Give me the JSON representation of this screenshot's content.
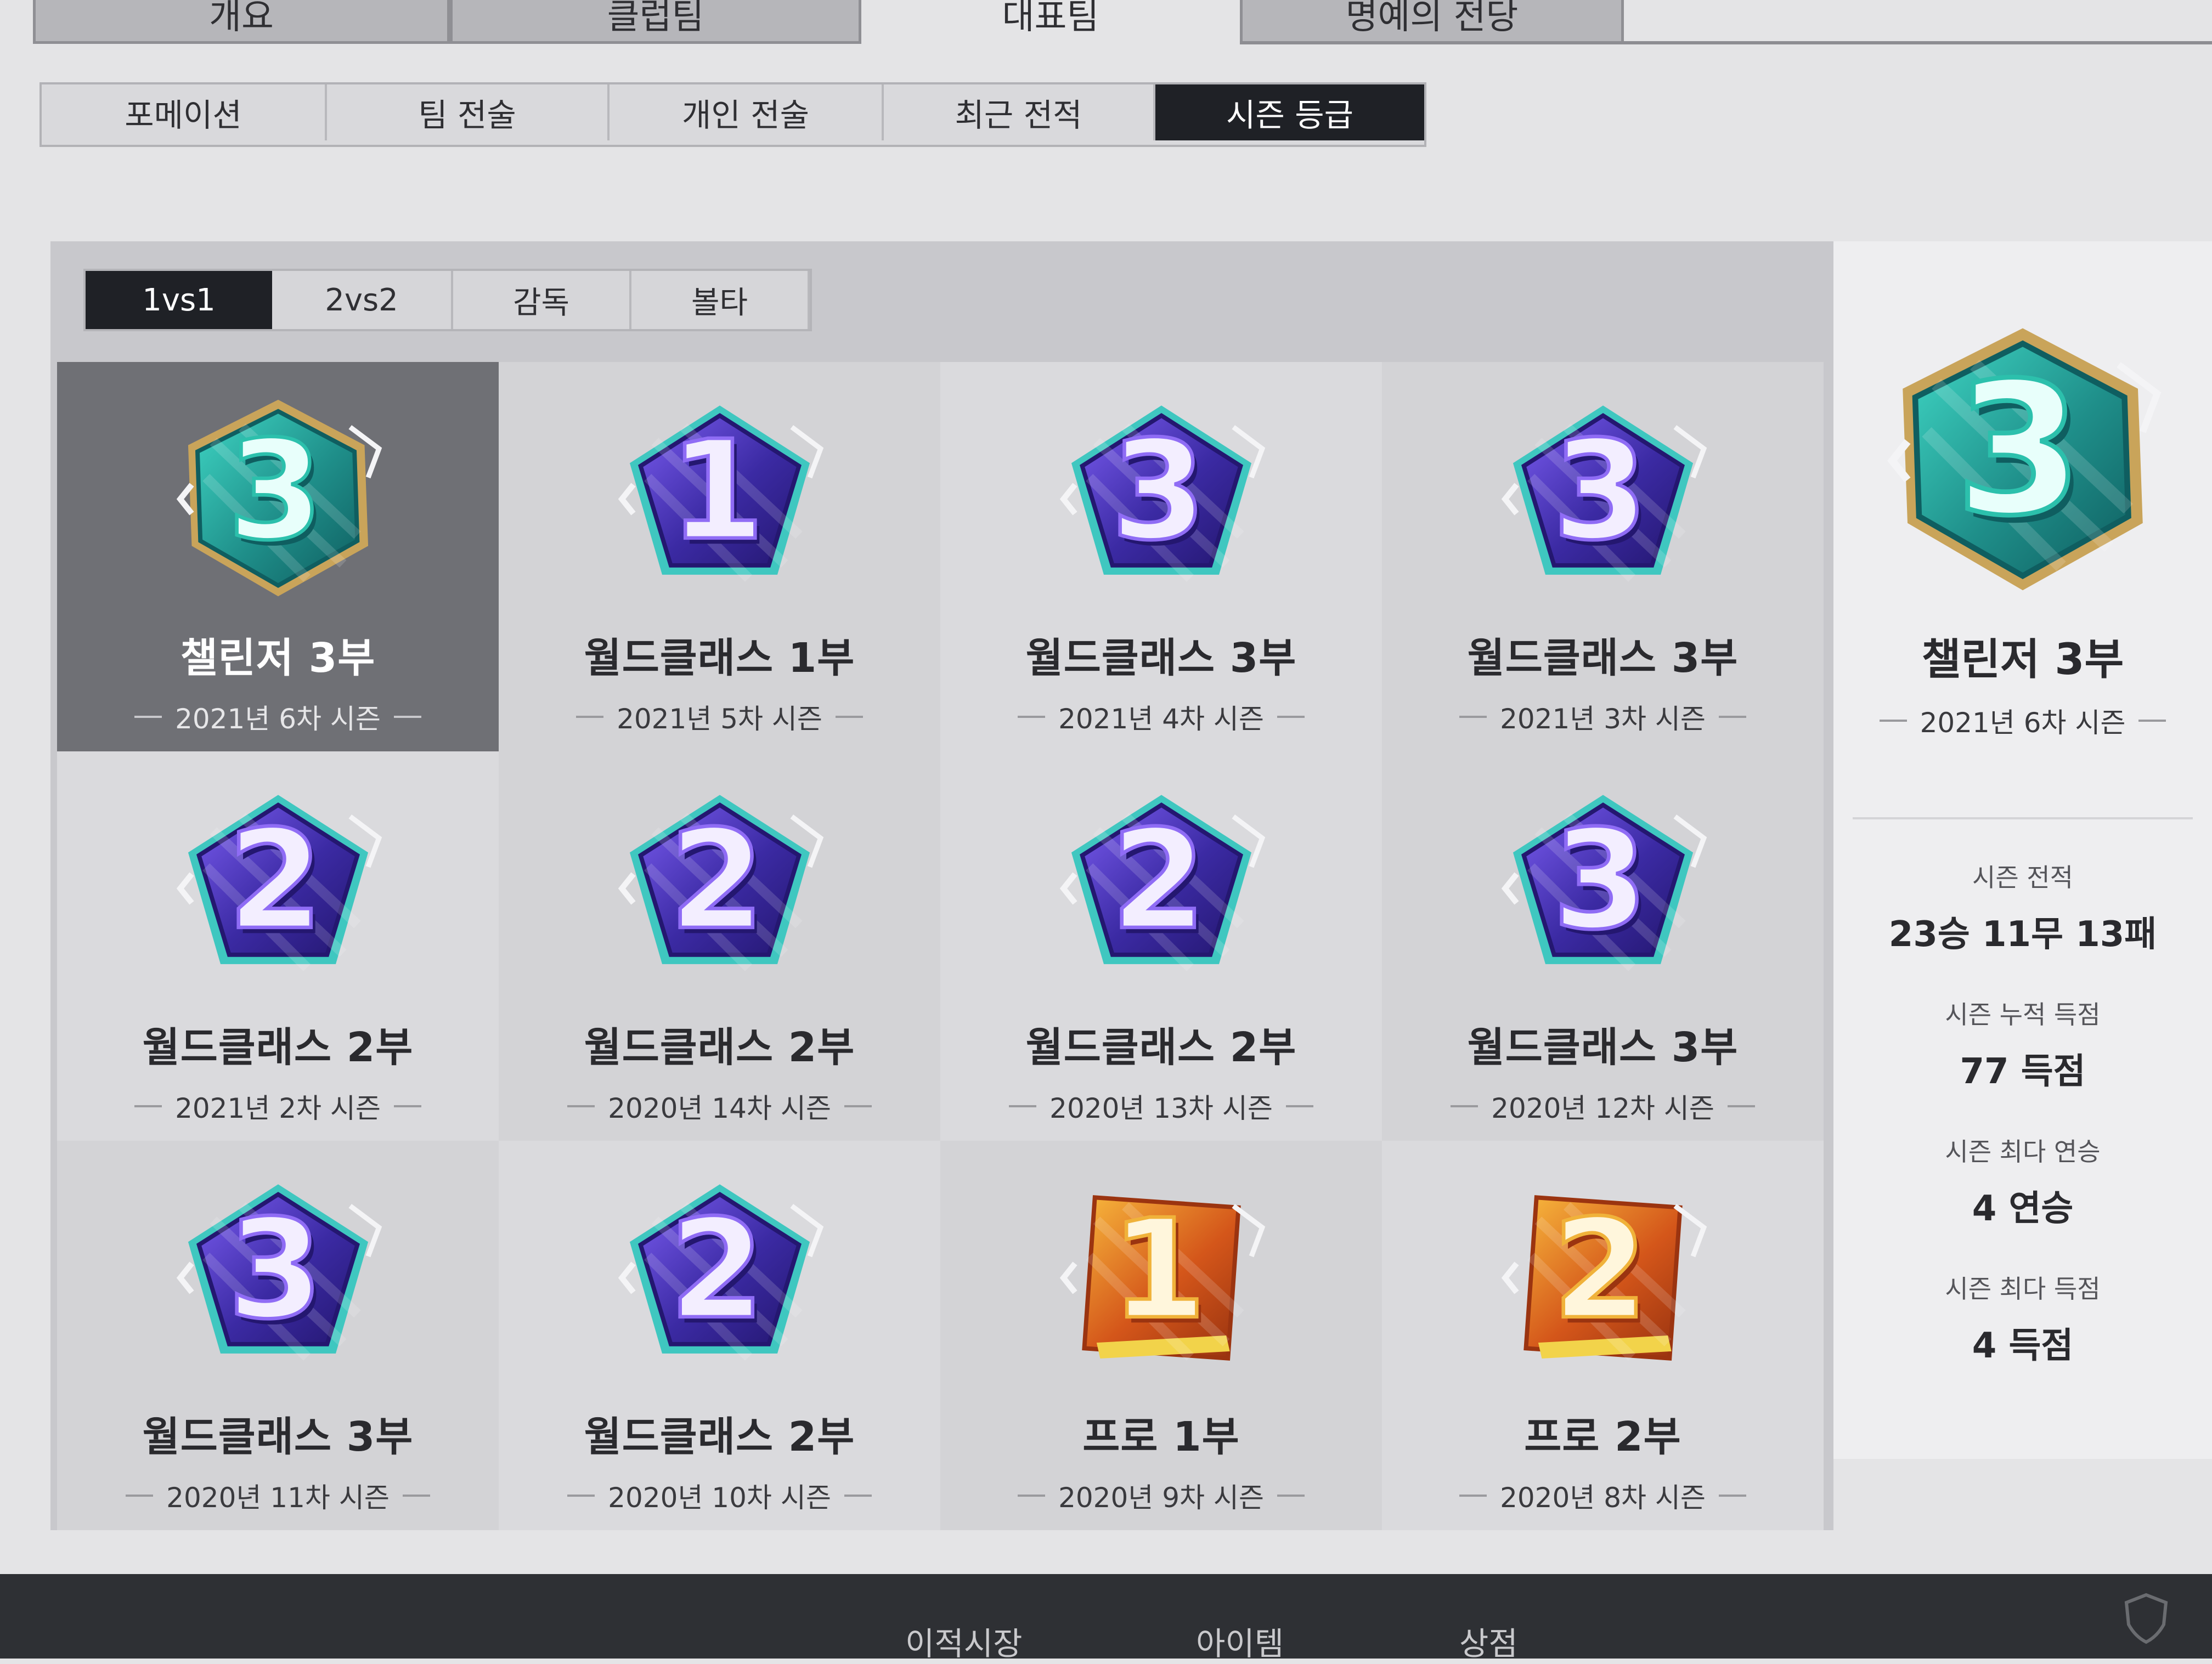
{
  "main_tabs": [
    "개요",
    "클럽팀",
    "대표팀",
    "명예의 전당"
  ],
  "sub_tabs": [
    "포메이션",
    "팀 전술",
    "개인 전술",
    "최근 전적",
    "시즌 등급"
  ],
  "mode_tabs": [
    "1vs1",
    "2vs2",
    "감독",
    "볼타"
  ],
  "cards": [
    {
      "digit": "3",
      "tier": "챌린저 3부",
      "season": "2021년 6차 시즌",
      "style": "teal"
    },
    {
      "digit": "1",
      "tier": "월드클래스 1부",
      "season": "2021년 5차 시즌",
      "style": "purple"
    },
    {
      "digit": "3",
      "tier": "월드클래스 3부",
      "season": "2021년 4차 시즌",
      "style": "purple"
    },
    {
      "digit": "3",
      "tier": "월드클래스 3부",
      "season": "2021년 3차 시즌",
      "style": "purple"
    },
    {
      "digit": "2",
      "tier": "월드클래스 2부",
      "season": "2021년 2차 시즌",
      "style": "purple"
    },
    {
      "digit": "2",
      "tier": "월드클래스 2부",
      "season": "2020년 14차 시즌",
      "style": "purple"
    },
    {
      "digit": "2",
      "tier": "월드클래스 2부",
      "season": "2020년 13차 시즌",
      "style": "purple"
    },
    {
      "digit": "3",
      "tier": "월드클래스 3부",
      "season": "2020년 12차 시즌",
      "style": "purple"
    },
    {
      "digit": "3",
      "tier": "월드클래스 3부",
      "season": "2020년 11차 시즌",
      "style": "purple"
    },
    {
      "digit": "2",
      "tier": "월드클래스 2부",
      "season": "2020년 10차 시즌",
      "style": "purple"
    },
    {
      "digit": "1",
      "tier": "프로 1부",
      "season": "2020년 9차 시즌",
      "style": "orange"
    },
    {
      "digit": "2",
      "tier": "프로 2부",
      "season": "2020년 8차 시즌",
      "style": "orange"
    }
  ],
  "current": {
    "digit": "3",
    "tier": "챌린저 3부",
    "season": "2021년 6차 시즌"
  },
  "stats": [
    {
      "label": "시즌 전적",
      "value": "23승 11무 13패"
    },
    {
      "label": "시즌 누적 득점",
      "value": "77 득점"
    },
    {
      "label": "시즌 최다 연승",
      "value": "4 연승"
    },
    {
      "label": "시즌 최다 득점",
      "value": "4 득점"
    }
  ],
  "bottom_nav": [
    "이적시장",
    "아이템",
    "상점"
  ],
  "colors": {
    "teal": "#27b3a3",
    "purple": "#5a3fc0",
    "orange": "#e3771f",
    "dark_tab": "#1f2126"
  }
}
